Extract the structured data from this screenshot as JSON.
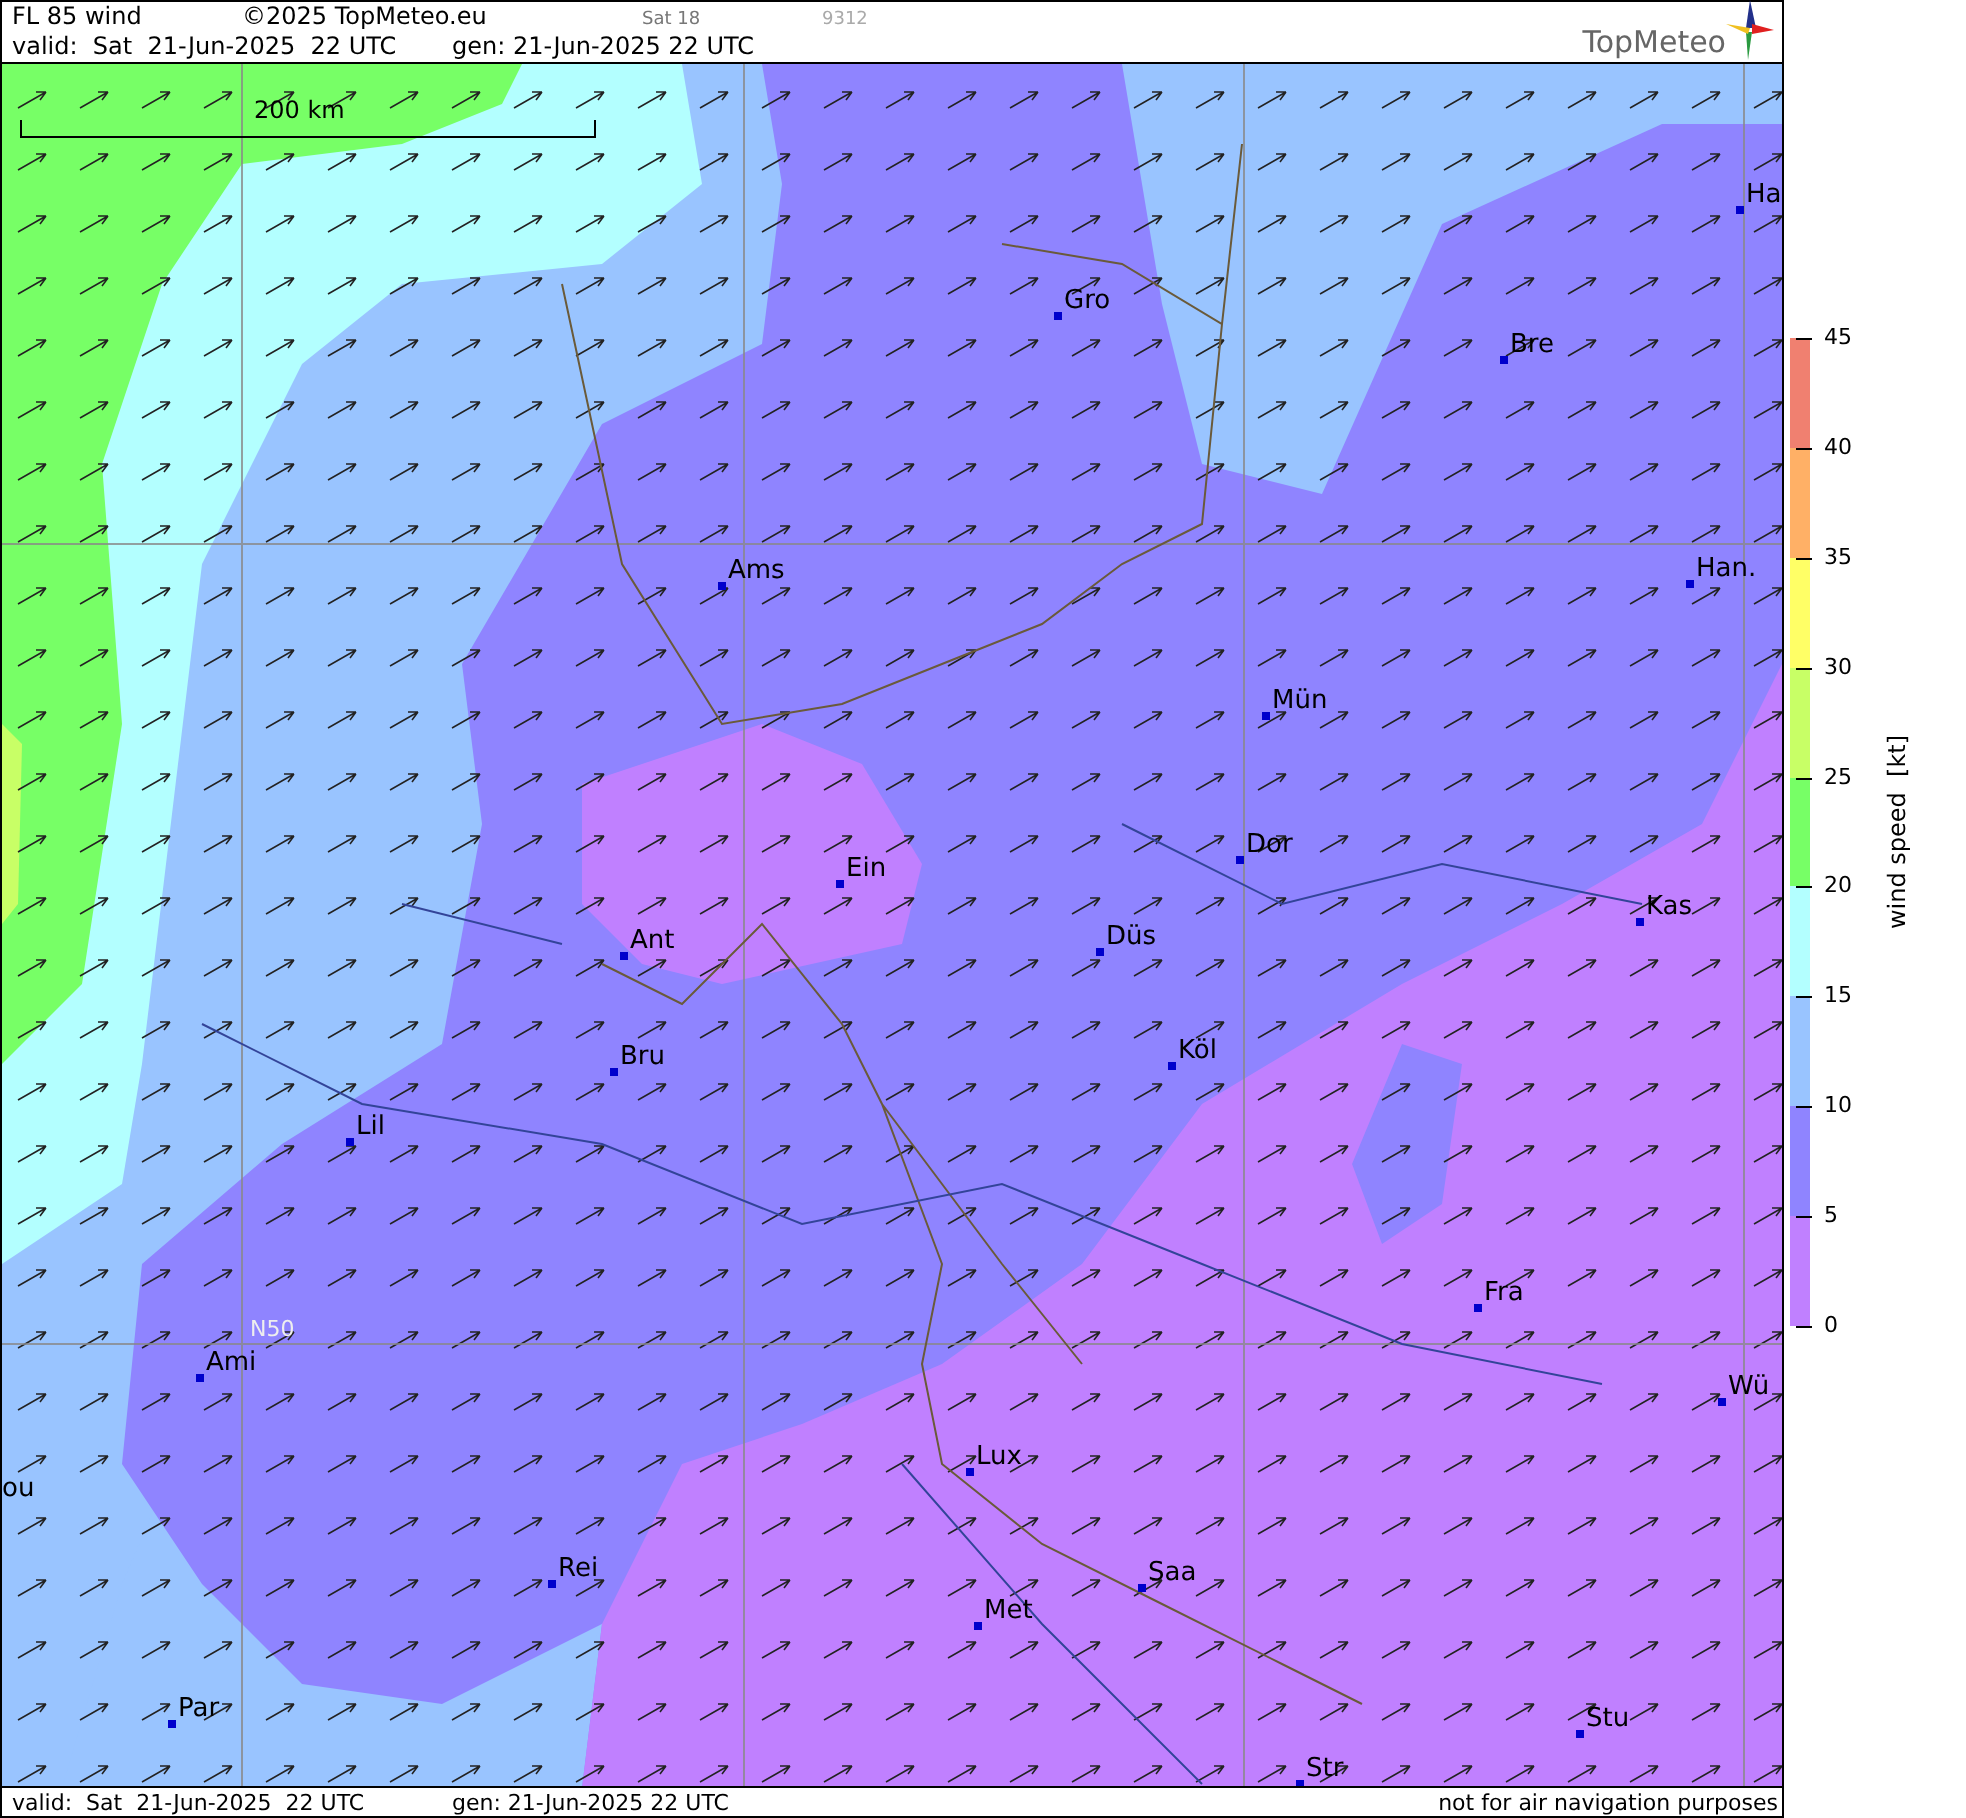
{
  "header": {
    "title": "FL 85 wind",
    "copyright": "©2025 TopMeteo.eu",
    "run": "Sat 18",
    "code": "9312",
    "valid": "valid:  Sat  21-Jun-2025  22 UTC",
    "generated": "gen: 21-Jun-2025 22 UTC",
    "logo": "TopMeteo"
  },
  "map": {
    "scale_label": "200 km",
    "grid_label": "N50",
    "cities": [
      {
        "name": "Ha"
      },
      {
        "name": "Gro"
      },
      {
        "name": "Bre"
      },
      {
        "name": "Ams"
      },
      {
        "name": "Han."
      },
      {
        "name": "Mün"
      },
      {
        "name": "Ein"
      },
      {
        "name": "Dor"
      },
      {
        "name": "Kas"
      },
      {
        "name": "Ant"
      },
      {
        "name": "Düs"
      },
      {
        "name": "Bru"
      },
      {
        "name": "Köl"
      },
      {
        "name": "Lil"
      },
      {
        "name": "Fra"
      },
      {
        "name": "Ami"
      },
      {
        "name": "Wü"
      },
      {
        "name": "ou"
      },
      {
        "name": "Lux"
      },
      {
        "name": "Rei"
      },
      {
        "name": "Saa"
      },
      {
        "name": "Met"
      },
      {
        "name": "Par"
      },
      {
        "name": "Stu"
      },
      {
        "name": "Str"
      }
    ]
  },
  "footer": {
    "valid": "valid:  Sat  21-Jun-2025  22 UTC",
    "generated": "gen: 21-Jun-2025 22 UTC",
    "notice": "not for air navigation purposes"
  },
  "legend": {
    "title": "wind speed  [kt]",
    "bands": [
      {
        "color": "#f08070"
      },
      {
        "color": "#ffb066"
      },
      {
        "color": "#ffff66"
      },
      {
        "color": "#c8ff66"
      },
      {
        "color": "#77ff66"
      },
      {
        "color": "#b3ffff"
      },
      {
        "color": "#99c4ff"
      },
      {
        "color": "#8f84ff"
      },
      {
        "color": "#c080ff"
      }
    ],
    "ticks": [
      "45",
      "40",
      "35",
      "30",
      "25",
      "20",
      "15",
      "10",
      "5",
      "0"
    ]
  }
}
